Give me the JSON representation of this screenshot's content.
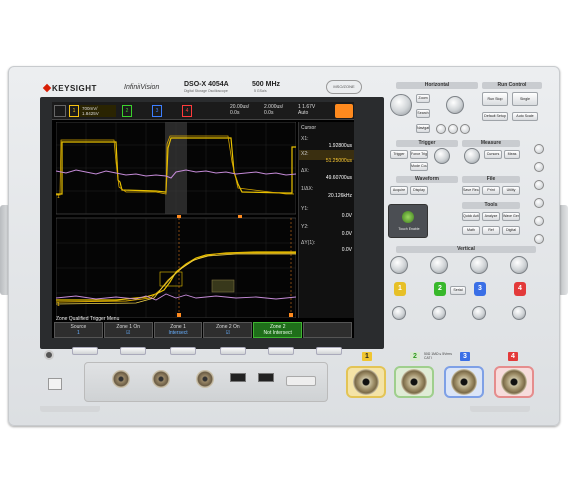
{
  "brand": {
    "name": "KEYSIGHT",
    "series": "InfiniiVision",
    "model": "DSO-X 4054A",
    "model_sub": "Digital Storage Oscilloscope",
    "bandwidth": "500 MHz",
    "sample_rate": "5 GSa/s",
    "badge": "MSO/ZONE"
  },
  "status": {
    "ch1_scale": "700mV/",
    "ch1_offset": "1.8425V",
    "ch1": "1",
    "ch2": "2",
    "ch3": "3",
    "ch4": "4",
    "timebase": "20.00us/",
    "delay": "0.0s",
    "time2": "2.000us/",
    "delay2": "0.0s",
    "trigger_level": "1.67V",
    "trigger_mode": "Auto",
    "trigger_ch": "1"
  },
  "cursor_panel": {
    "title": "Cursor",
    "x1_label": "X1:",
    "x1": "1.92800us",
    "x2_label": "X2:",
    "x2": "51.25000us",
    "dx_label": "ΔX:",
    "dx": "49.60700us",
    "inv_dx_label": "1/ΔX:",
    "inv_dx": "20.126kHz",
    "y1_label": "Y1:",
    "y1": "0.0V",
    "y2_label": "Y2:",
    "y2": "0.0V",
    "dy_label": "ΔY(1):",
    "dy": "0.0V"
  },
  "menu": {
    "title": "Zone Qualified Trigger Menu",
    "softkeys": [
      {
        "label": "Source",
        "value": "1"
      },
      {
        "label": "Zone 1 On",
        "value": ""
      },
      {
        "label": "Zone 1",
        "value": "Intersect"
      },
      {
        "label": "Zone 2 On",
        "value": ""
      },
      {
        "label": "Zone 2",
        "value": "Not Intersect"
      }
    ]
  },
  "panel": {
    "horizontal": "Horizontal",
    "run_control": "Run Control",
    "trigger": "Trigger",
    "measure": "Measure",
    "waveform": "Waveform",
    "file": "File",
    "tools": "Tools",
    "vertical": "Vertical",
    "btn_zoom": "Zoom",
    "btn_search": "Search",
    "btn_navigate": "Navigate",
    "btn_run_stop": "Run Stop",
    "btn_single": "Single",
    "btn_default": "Default Setup",
    "btn_auto": "Auto Scale",
    "btn_trigger": "Trigger",
    "btn_force": "Force Trigger",
    "btn_mode": "Mode Coupling",
    "btn_cursors": "Cursors",
    "btn_meas": "Meas",
    "btn_acquire": "Acquire",
    "btn_display": "Display",
    "btn_save": "Save Recall",
    "btn_print": "Print",
    "btn_utility": "Utility",
    "btn_quick": "Quick Action",
    "btn_analyze": "Analyze",
    "btn_wavegen": "Wave Gen",
    "btn_math": "Math",
    "btn_ref": "Ref",
    "btn_digital": "Digital",
    "btn_serial": "Serial",
    "btn_touch": "Touch",
    "touch_caption": "Touch Enable"
  },
  "inputs": [
    "1",
    "2",
    "3",
    "4"
  ],
  "input_note": "50Ω 1MΩ ≤ 5Vrms CAT I",
  "colors": {
    "ch1": "#f5c211",
    "ch2": "#3bd12c",
    "ch3": "#3d7fff",
    "ch4": "#ff3b3b",
    "ch1_trace": "#e9c200",
    "math_trace": "#c58bd8",
    "run": "#ff8a1e"
  }
}
